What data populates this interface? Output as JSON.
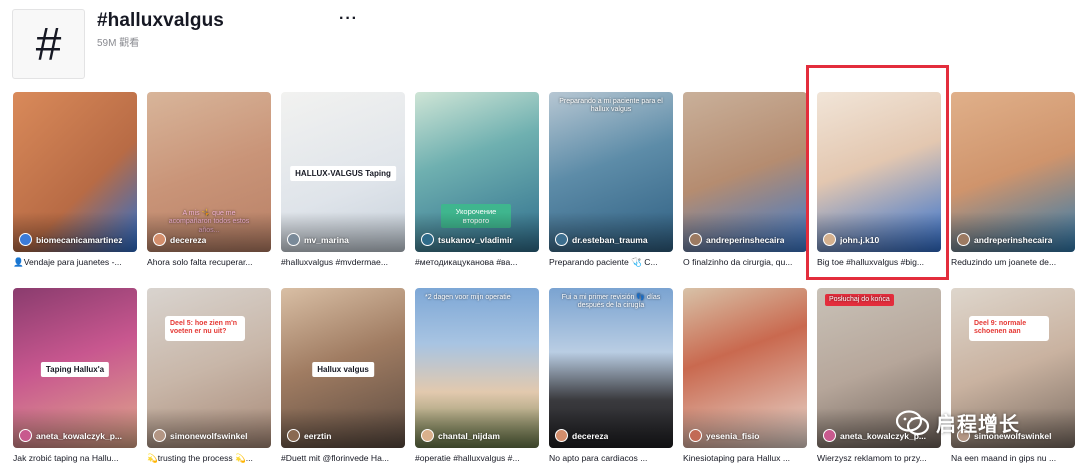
{
  "header": {
    "hashtag_symbol": "#",
    "title": "#halluxvalgus",
    "views": "59M 觀看",
    "more_label": "···"
  },
  "videos_row1": [
    {
      "author": "biomecanicamartinez",
      "caption": "👤Vendaje para juanetes -...",
      "bg": "linear-gradient(135deg,#d98a5a,#b86b45 60%,#2a6fd0)",
      "av": "#3b7bd8"
    },
    {
      "author": "decereza",
      "caption": "Ahora solo falta recuperar...",
      "bg": "linear-gradient(160deg,#d8b59a,#c99478 50%,#b88066)",
      "av": "#d38e6c",
      "overlay": "A mis 🤸 que me acompañaron todos estos años...",
      "overlay_style": "pink"
    },
    {
      "author": "mv_marina",
      "caption": "#halluxvalgus #mvdermae...",
      "bg": "linear-gradient(160deg,#f2f2f0,#dfe4ea 60%,#c7d1db)",
      "av": "#7a8a99",
      "overlay": "HALLUX-VALGUS Taping",
      "overlay_style": "white"
    },
    {
      "author": "tsukanov_vladimir",
      "caption": "#методикацуканова #ва...",
      "bg": "linear-gradient(160deg,#cfe5d6,#6fb0b0 40%,#2f6e8d)",
      "av": "#2e6b89",
      "overlay": "Укорочение второго",
      "overlay_style": "green"
    },
    {
      "author": "dr.esteban_trauma",
      "caption": "Preparando paciente 🩺 C...",
      "bg": "linear-gradient(160deg,#b7c7d3,#5d8ca8 45%,#2f5f82)",
      "av": "#3d6e8e",
      "overlay": "Preparando a mi paciente para el hallux valgus",
      "overlay_style": "plain"
    },
    {
      "author": "andreperinshecaira",
      "caption": "O finalzinho da cirurgia, qu...",
      "bg": "linear-gradient(160deg,#c9b09a,#b58c70 50%,#3b7bd0)",
      "av": "#9c7a62"
    },
    {
      "author": "john.j.k10",
      "caption": "Big toe #halluxvalgus #big...",
      "bg": "linear-gradient(160deg,#f1e5d8,#e3c7b0 45%,#2f6fd0)",
      "av": "#d4b08e"
    },
    {
      "author": "andreperinshecaira",
      "caption": "Reduzindo um joanete de...",
      "bg": "linear-gradient(160deg,#e0b08a,#cf946c 50%,#2f7bb0)",
      "av": "#9c7a62"
    }
  ],
  "videos_row2": [
    {
      "author": "aneta_kowalczyk_p...",
      "caption": "Jak zrobić taping na Hallu...",
      "bg": "linear-gradient(160deg,#8a3c6e,#c8578f 45%,#e0a98a)",
      "av": "#c85a8e",
      "overlay": "Taping Hallux'a",
      "overlay_style": "white"
    },
    {
      "author": "simonewolfswinkel",
      "caption": "💫trusting the process 💫...",
      "bg": "linear-gradient(160deg,#d9d4cf,#c8b6a8 50%,#a88a78)",
      "av": "#b39684",
      "overlay": "Deel 5: hoe zien m'n voeten er nu uit?",
      "overlay_style": "red"
    },
    {
      "author": "eerztin",
      "caption": "#Duett mit @florinvede Ha...",
      "bg": "linear-gradient(160deg,#d9bfa5,#a07c62 45%,#5a4a40)",
      "av": "#8a6a52",
      "overlay": "Hallux valgus",
      "overlay_style": "white"
    },
    {
      "author": "chantal_nijdam",
      "caption": "#operatie #halluxvalgus #...",
      "bg": "linear-gradient(180deg,#7da7d6,#a8c4e2 35%,#e2c9ae 65%,#6a7a4a)",
      "av": "#d9b08c",
      "overlay": "*2 dagen voor mijn operatie",
      "overlay_style": "plain"
    },
    {
      "author": "decereza",
      "caption": "No apto para cardiacos ...",
      "bg": "linear-gradient(180deg,#7aa3d1,#b9cde3 40%,#3a3a3e 70%,#1f1f22)",
      "av": "#d38e6c",
      "overlay": "Fui a mi primer revisión 👣 días después de la cirugía",
      "overlay_style": "plain"
    },
    {
      "author": "yesenia_fisio",
      "caption": "Kinesiotaping para Hallux ...",
      "bg": "linear-gradient(160deg,#d8c2a8,#c9694f 40%,#e8d8cf)",
      "av": "#c26a56"
    },
    {
      "author": "aneta_kowalczyk_p...",
      "caption": "Wierzysz reklamom to przy...",
      "bg": "linear-gradient(160deg,#c9c2b8,#b6a69a 50%,#6e625a)",
      "av": "#c85a8e",
      "overlay": "Posłuchaj do końca",
      "overlay_style": "redfill"
    },
    {
      "author": "simonewolfswinkel",
      "caption": "Na een maand in gips nu ...",
      "bg": "linear-gradient(160deg,#ded6cc,#c9b2a0 50%,#7a6c62)",
      "av": "#b39684",
      "overlay": "Deel 9: normale schoenen aan",
      "overlay_style": "red"
    }
  ],
  "watermark": {
    "text": "启程增长"
  },
  "colors": {
    "highlight": "#e32d3c",
    "text": "#161823",
    "muted": "#8a8b91"
  }
}
